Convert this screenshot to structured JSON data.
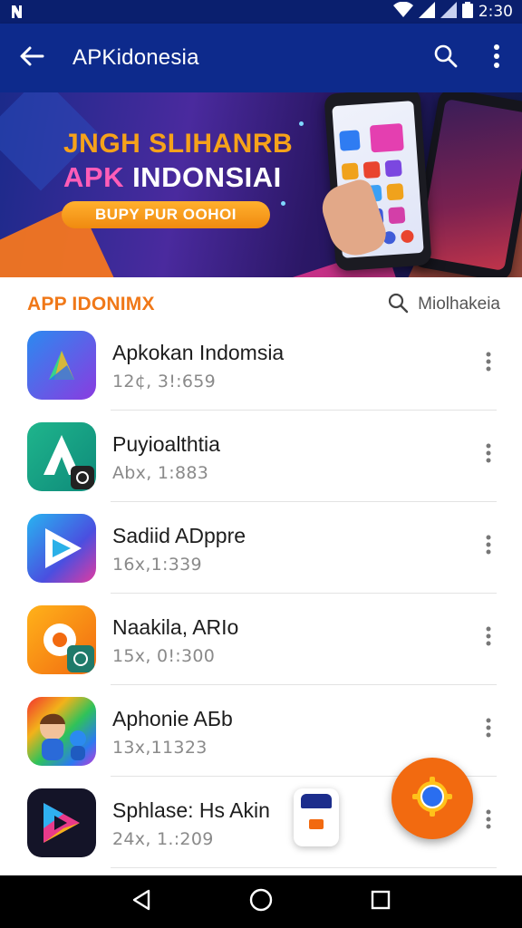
{
  "status_bar": {
    "time": "2:30",
    "icons": [
      "notification-icon",
      "wifi-icon",
      "signal-icon",
      "signal-icon-2",
      "battery-icon"
    ]
  },
  "app_bar": {
    "title": "APKidonesia",
    "back_icon": "back-arrow-icon",
    "actions": [
      "search-icon",
      "more-vert-icon"
    ],
    "bg_color": "#0d2a8c"
  },
  "banner": {
    "line1": "JNGH SLIHANRB",
    "line2_prefix": "APK",
    "line2_rest": " INDONSIAI",
    "cta": "BUPY PUR OOHOI"
  },
  "section": {
    "title": "APP IDONIMX",
    "search_label": "Miolhakeia",
    "title_color": "#f07818"
  },
  "apps": [
    {
      "name": "Apkokan Indomsia",
      "meta": "12¢, 3!:659"
    },
    {
      "name": "Puyioalthtia",
      "meta": "Abx, 1:883"
    },
    {
      "name": "Sadiid ADppre",
      "meta": "16x,1:339"
    },
    {
      "name": "Naakila, ARIo",
      "meta": "15x, 0!:300"
    },
    {
      "name": "Aphonie AБb",
      "meta": "13x,11323"
    },
    {
      "name": "Sphlase: Hs Akin",
      "meta": "24x, 1.:209"
    }
  ],
  "fab": {
    "icon": "settings-gear-icon",
    "color": "#f26a10"
  },
  "nav_bar": {
    "icons": [
      "back-triangle-icon",
      "home-circle-icon",
      "recents-square-icon"
    ]
  }
}
